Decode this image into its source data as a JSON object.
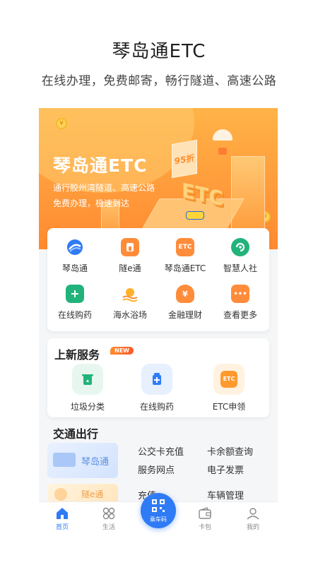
{
  "promo": {
    "title": "琴岛通ETC",
    "subtitle": "在线办理，免费邮寄，畅行隧道、高速公路"
  },
  "banner": {
    "title": "琴岛通ETC",
    "line1": "通行胶州湾隧道、高速公路",
    "line2": "免费办理，极速到达",
    "sign_text": "95折",
    "etc_3d_text": "ETC",
    "coin_symbol": "¥"
  },
  "services_grid": [
    {
      "label": "琴岛通",
      "icon": "qindaotong-logo-icon",
      "color": "#2f7bf5"
    },
    {
      "label": "隧e通",
      "icon": "tunnel-icon",
      "color": "#ff8c3a"
    },
    {
      "label": "琴岛通ETC",
      "icon": "etc-icon",
      "color": "#ff8c3a",
      "icon_text": "ETC"
    },
    {
      "label": "智慧人社",
      "icon": "social-security-icon",
      "color": "#21b37a"
    },
    {
      "label": "在线购药",
      "icon": "medicine-icon",
      "color": "#21b37a"
    },
    {
      "label": "海水浴场",
      "icon": "beach-icon",
      "color": "#ffb12b"
    },
    {
      "label": "金融理财",
      "icon": "finance-icon",
      "color": "#ff8c3a",
      "icon_text": "¥"
    },
    {
      "label": "查看更多",
      "icon": "more-icon",
      "color": "#ff8c3a",
      "icon_text": "•••"
    }
  ],
  "new_services": {
    "title": "上新服务",
    "badge": "NEW",
    "items": [
      {
        "label": "垃圾分类",
        "icon": "trash-sort-icon",
        "color": "#21b37a",
        "bg": "#e7f7ef"
      },
      {
        "label": "在线购药",
        "icon": "medicine-icon",
        "color": "#2f7bf5",
        "bg": "#e6f0fe"
      },
      {
        "label": "ETC申领",
        "icon": "etc-icon",
        "color": "#ff9a2e",
        "bg": "#fff2e0",
        "icon_text": "ETC"
      }
    ]
  },
  "traffic": {
    "title": "交通出行",
    "card1_label": "琴岛通",
    "card2_label": "隧e通",
    "links": [
      "公交卡充值",
      "卡余额查询",
      "服务网点",
      "电子发票",
      "充值",
      "车辆管理"
    ]
  },
  "tabbar": {
    "items": [
      {
        "label": "首页",
        "icon": "home-icon",
        "active": true
      },
      {
        "label": "生活",
        "icon": "life-icon",
        "active": false
      },
      {
        "label": "卡包",
        "icon": "wallet-icon",
        "active": false
      },
      {
        "label": "我的",
        "icon": "profile-icon",
        "active": false
      }
    ],
    "ride_label": "乘车码"
  },
  "colors": {
    "accent": "#2f7bf5",
    "banner_orange": "#ff9a3a"
  }
}
